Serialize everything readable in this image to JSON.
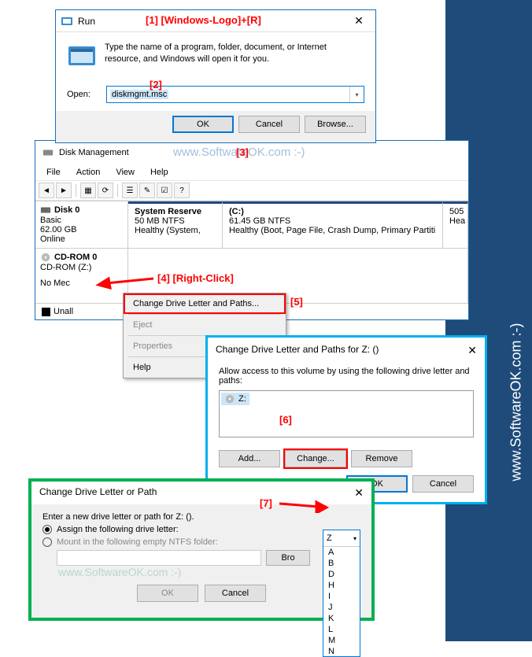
{
  "side_watermark": "www.SoftwareOK.com :-)",
  "annotations": {
    "a1": "[1]  [Windows-Logo]+[R]",
    "a2": "[2]",
    "a3": "[3]",
    "a4": "[4]  [Right-Click]",
    "a5": "[5]",
    "a6": "[6]",
    "a7": "[7]"
  },
  "run": {
    "title": "Run",
    "desc": "Type the name of a program, folder, document, or Internet resource, and Windows will open it for you.",
    "open_label": "Open:",
    "value": "diskmgmt.msc",
    "ok": "OK",
    "cancel": "Cancel",
    "browse": "Browse..."
  },
  "dm": {
    "title": "Disk Management",
    "menu": {
      "file": "File",
      "action": "Action",
      "view": "View",
      "help": "Help"
    },
    "disk0": {
      "name": "Disk 0",
      "type": "Basic",
      "size": "62.00 GB",
      "status": "Online",
      "p1_name": "System Reserve",
      "p1_size": "50 MB NTFS",
      "p1_status": "Healthy (System,",
      "p2_name": "(C:)",
      "p2_size": "61.45 GB NTFS",
      "p2_status": "Healthy (Boot, Page File, Crash Dump, Primary Partiti",
      "p3_name": "",
      "p3_size": "505",
      "p3_status": "Hea"
    },
    "cd": {
      "name": "CD-ROM 0",
      "sub": "CD-ROM (Z:)",
      "nomedia": "No Mec"
    },
    "legend": "Unall",
    "watermark": "www.SoftwareOK.com :-)"
  },
  "ctx": {
    "change": "Change Drive Letter and Paths...",
    "eject": "Eject",
    "props": "Properties",
    "help": "Help"
  },
  "chg": {
    "title": "Change Drive Letter and Paths for Z: ()",
    "desc": "Allow access to this volume by using the following drive letter and paths:",
    "drive": "Z:",
    "add": "Add...",
    "change": "Change...",
    "remove": "Remove",
    "ok": "OK",
    "cancel": "Cancel"
  },
  "chgp": {
    "title": "Change Drive Letter or Path",
    "desc": "Enter a new drive letter or path for Z: ().",
    "opt1": "Assign the following drive letter:",
    "opt2": "Mount in the following empty NTFS folder:",
    "browse": "Bro",
    "ok": "OK",
    "cancel": "Cancel",
    "selected": "Z",
    "letters": [
      "A",
      "B",
      "D",
      "H",
      "I",
      "J",
      "K",
      "L",
      "M",
      "N"
    ],
    "watermark": "www.SoftwareOK.com :-)"
  }
}
